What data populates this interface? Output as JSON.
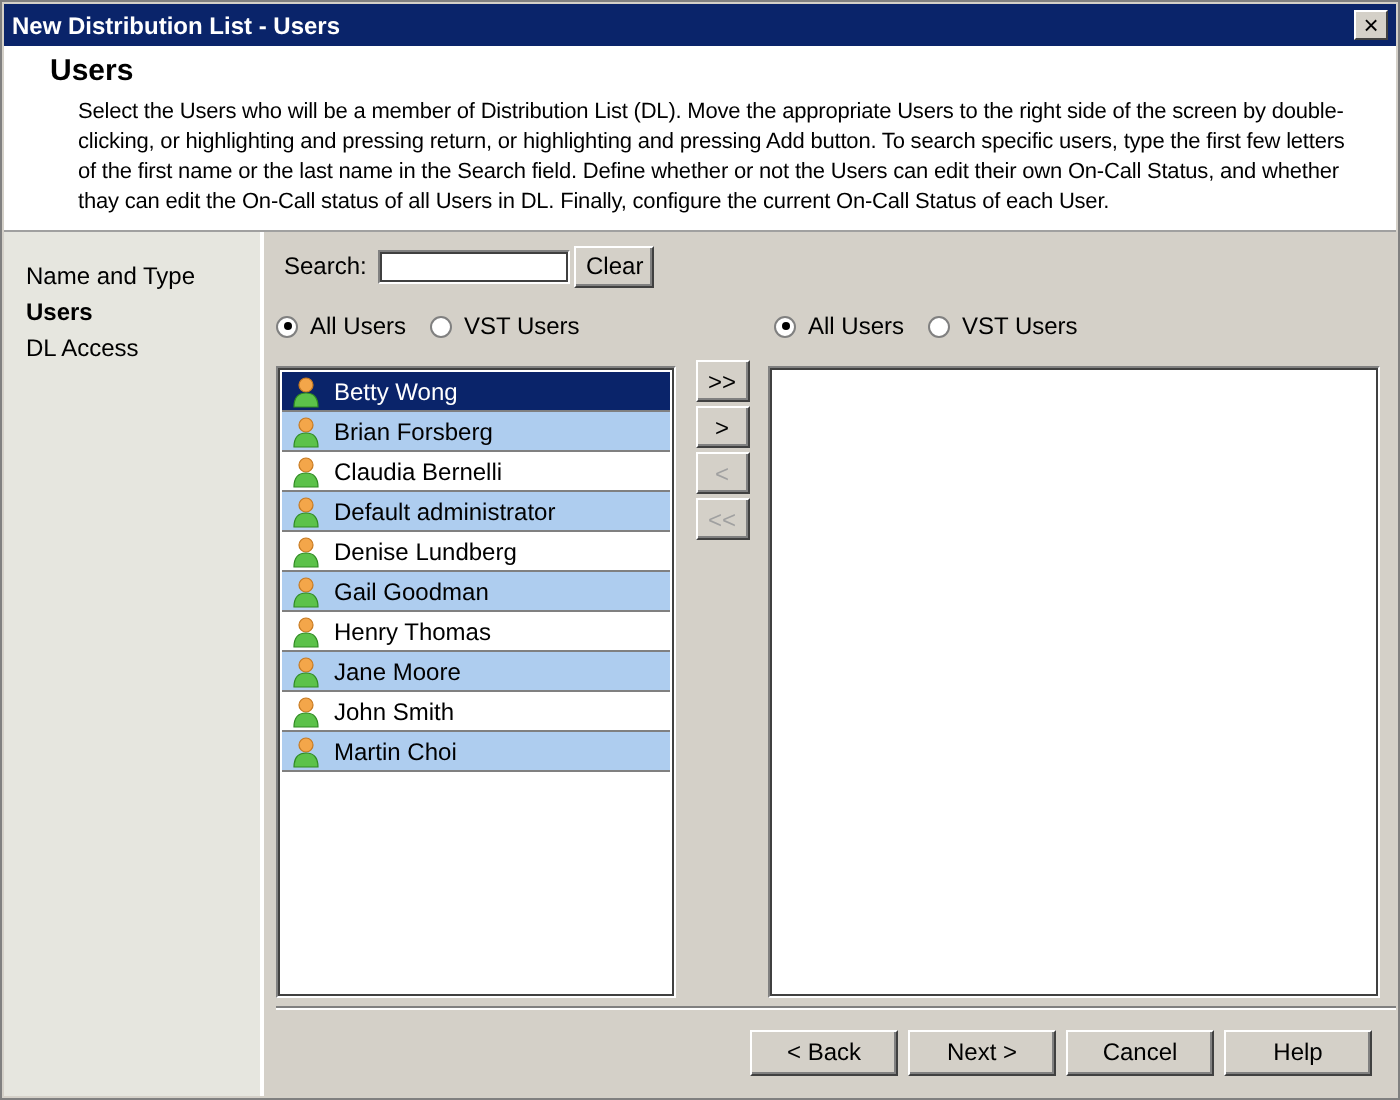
{
  "window": {
    "title": "New Distribution List - Users",
    "close": "×"
  },
  "header": {
    "title": "Users",
    "description": "Select the Users who will be a member of Distribution List (DL). Move the appropriate Users to the right side of the screen by double-clicking, or highlighting and pressing return, or highlighting and pressing Add button. To search specific users, type the first few letters of the first name or the last name in the Search field. Define whether or not the Users can edit their own On-Call Status, and whether thay can edit the On-Call status of all Users in DL. Finally, configure the current On-Call Status of each User."
  },
  "sidebar": {
    "items": [
      {
        "label": "Name and Type",
        "selected": false
      },
      {
        "label": "Users",
        "selected": true
      },
      {
        "label": "DL Access",
        "selected": false
      }
    ]
  },
  "search": {
    "label": "Search:",
    "button": "Clear"
  },
  "left_filter": [
    {
      "label": "All Users",
      "selected": true
    },
    {
      "label": "VST Users",
      "selected": false
    }
  ],
  "right_filter": [
    {
      "label": "All Users",
      "selected": true
    },
    {
      "label": "VST Users",
      "selected": false
    }
  ],
  "available_users": [
    {
      "name": "Betty Wong",
      "selected": true
    },
    {
      "name": "Brian Forsberg",
      "selected": false
    },
    {
      "name": "Claudia Bernelli",
      "selected": false
    },
    {
      "name": "Default administrator",
      "selected": false
    },
    {
      "name": "Denise Lundberg",
      "selected": false
    },
    {
      "name": "Gail Goodman",
      "selected": false
    },
    {
      "name": "Henry Thomas",
      "selected": false
    },
    {
      "name": "Jane Moore",
      "selected": false
    },
    {
      "name": "John Smith",
      "selected": false
    },
    {
      "name": "Martin Choi",
      "selected": false
    }
  ],
  "move_buttons": [
    {
      "label": ">>",
      "disabled": false
    },
    {
      "label": ">",
      "disabled": false
    },
    {
      "label": "<",
      "disabled": true
    },
    {
      "label": "<<",
      "disabled": true
    }
  ],
  "footer_buttons": [
    "< Back",
    "Next >",
    "Cancel",
    "Help"
  ]
}
